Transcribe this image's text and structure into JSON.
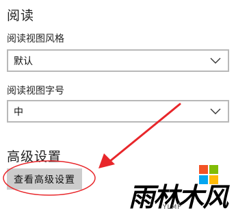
{
  "reading": {
    "title": "阅读",
    "view_style_label": "阅读视图风格",
    "view_style_value": "默认",
    "font_size_label": "阅读视图字号",
    "font_size_value": "中"
  },
  "advanced": {
    "title": "高级设置",
    "view_button": "查看高级设置"
  },
  "annotation": {
    "arrow_color": "#e8262a",
    "highlight_color": "#e8262a"
  },
  "watermark": {
    "text": "雨林木风",
    "sub": "YLMF",
    "colors": [
      "#f35325",
      "#81bc06",
      "#05a6f0",
      "#ffba08"
    ]
  }
}
